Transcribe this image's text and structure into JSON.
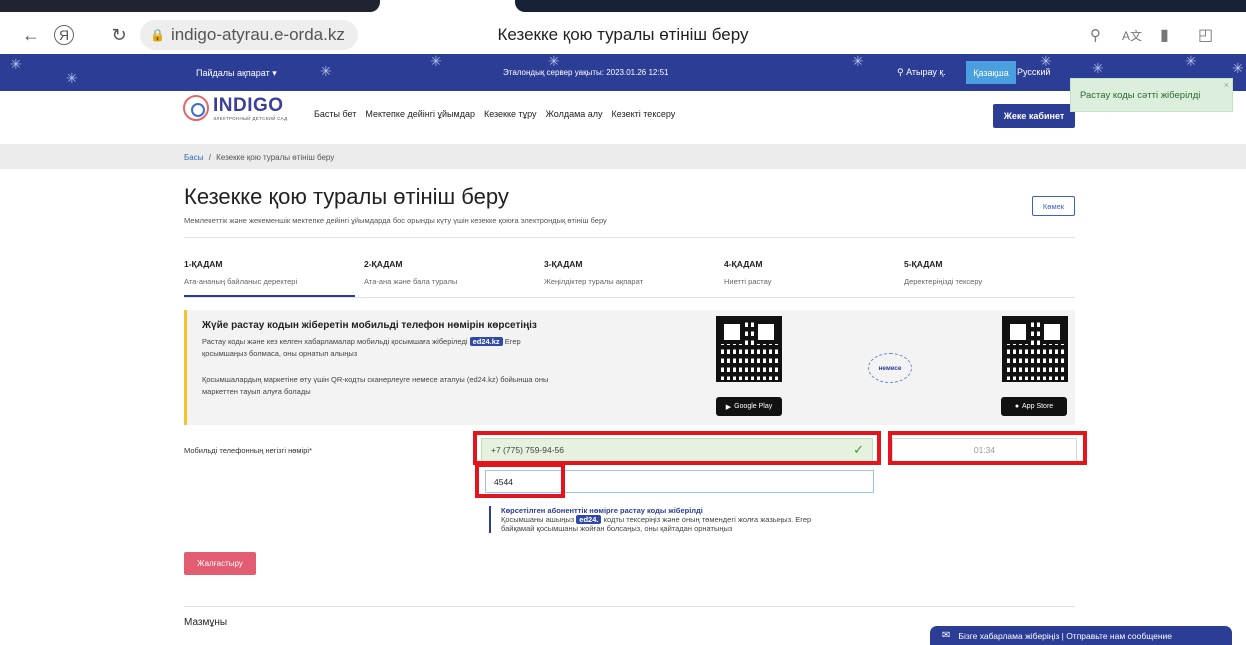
{
  "browser": {
    "url": "indigo-atyrau.e-orda.kz",
    "tab_title": "Кезекке қою туралы өтініш беру",
    "back_icon": "←",
    "yandex_icon": "Я",
    "reload_icon": "↻",
    "lock_icon": "🔒"
  },
  "site_top": {
    "useful_info": "Пайдалы ақпарат ▾",
    "server_time": "Эталондық сервер уақыты: 2023.01.26 12:51",
    "city": "Атырау қ.",
    "lang_kz": "Қазақша",
    "lang_ru": "Русский"
  },
  "nav": {
    "logo_title": "INDIGO",
    "logo_subtitle": "ЭЛЕКТРОННЫЙ ДЕТСКИЙ САД",
    "links": [
      "Басты бет",
      "Мектепке дейінгі ұйымдар",
      "Кезекке тұру",
      "Жолдама алу",
      "Кезекті тексеру"
    ],
    "cabinet": "Жеке кабинет"
  },
  "toast": {
    "message": "Растау коды сәтті жіберілді",
    "close": "×"
  },
  "breadcrumb": {
    "home": "Басы",
    "separator": "/",
    "current": "Кезекке қою туралы өтініш беру"
  },
  "page": {
    "title": "Кезекке қою туралы өтініш беру",
    "subtitle": "Мемлекеттік және жекеменшік мектепке дейінгі ұйымдарда бос орынды күту үшін кезекке қоюға электрондық өтініш беру",
    "help": "Көмек"
  },
  "steps": [
    {
      "title": "1-ҚАДАМ",
      "desc": "Ата-ананың байланыс деректері"
    },
    {
      "title": "2-ҚАДАМ",
      "desc": "Ата-ана және бала туралы"
    },
    {
      "title": "3-ҚАДАМ",
      "desc": "Жеңілдіктер туралы ақпарат"
    },
    {
      "title": "4-ҚАДАМ",
      "desc": "Ниетті растау"
    },
    {
      "title": "5-ҚАДАМ",
      "desc": "Деректеріңізді тексеру"
    }
  ],
  "info": {
    "title": "Жүйе растау кодын жіберетін мобильді телефон нөмірін көрсетіңіз",
    "line1_a": "Растау коды және кез келген хабарламалар мобильді қосымшаға жіберіледі",
    "tag": "ed24.kz",
    "line1_b": "Егер",
    "line2": "қосымшаңыз болмаса, оны орнатып алыңыз",
    "line3": "Қосымшалардың маркетіне өту үшін QR-кодты сканерлеуге немесе аталуы (ed24.kz) бойынша оны",
    "line4": "маркеттен тауып алуға болады",
    "or": "немесе",
    "google_play": "Google Play",
    "app_store": "App Store"
  },
  "form": {
    "phone_label": "Мобильді телефонның негізгі нөмірі*",
    "phone_value": "+7 (775) 759-94-56",
    "timer": "01:34",
    "code_value": "4544"
  },
  "notice": {
    "title": "Көрсетілген абоненттік нөмірге растау коды жіберілді",
    "line1_a": "Қосымшаны ашыңыз",
    "tag": "ed24.",
    "line1_b": "кодты тексеріңіз және оның төмендегі жолға жазыңыз. Егер",
    "line2": "байқамай қосымшаны жойған болсаңыз, оны қайтадан орнатыңыз"
  },
  "actions": {
    "continue": "Жалғастыру"
  },
  "contents": {
    "title": "Мазмұны"
  },
  "chat": {
    "label": "Бізге хабарлама жіберіңіз | Отправьте нам сообщение"
  },
  "colors": {
    "brand": "#2c3d96",
    "accent_pink": "#e25c72",
    "highlight": "#e3141c"
  }
}
